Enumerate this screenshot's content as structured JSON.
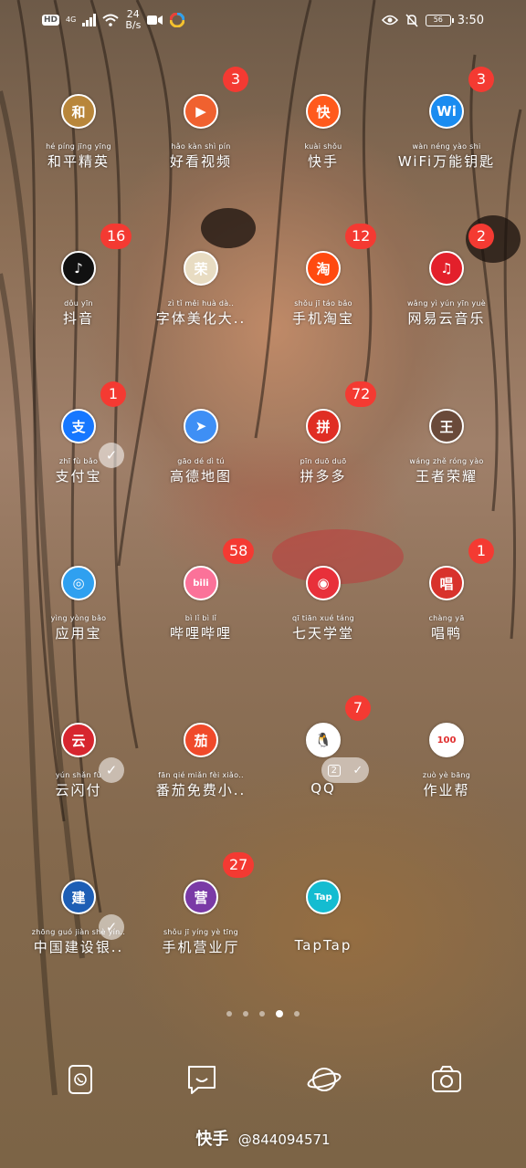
{
  "statusbar": {
    "hd": "HD",
    "network": "4G",
    "speed_value": "24",
    "speed_unit": "B/s",
    "battery": "56",
    "time": "3:50"
  },
  "apps": [
    {
      "pinyin": "hé píng jīng yīng",
      "label": "和平精英",
      "badge": "",
      "color": "#b8863b",
      "glyph": "和"
    },
    {
      "pinyin": "hǎo kàn shì pín",
      "label": "好看视频",
      "badge": "3",
      "color": "#f0612f",
      "glyph": "▶"
    },
    {
      "pinyin": "kuài shǒu",
      "label": "快手",
      "badge": "",
      "color": "#ff5a1c",
      "glyph": "快"
    },
    {
      "pinyin": "wàn néng yào shi",
      "label": "WiFi万能钥匙",
      "badge": "3",
      "color": "#1a8cf0",
      "glyph": "Wi"
    },
    {
      "pinyin": "dǒu yīn",
      "label": "抖音",
      "badge": "16",
      "color": "#111111",
      "glyph": "♪"
    },
    {
      "pinyin": "zì tǐ měi huà dà..",
      "label": "字体美化大..",
      "badge": "",
      "color": "#e8dcc2",
      "glyph": "荣"
    },
    {
      "pinyin": "shǒu jī táo bǎo",
      "label": "手机淘宝",
      "badge": "12",
      "color": "#ff4a10",
      "glyph": "淘"
    },
    {
      "pinyin": "wǎng yì yún yīn yuè",
      "label": "网易云音乐",
      "badge": "2",
      "color": "#e3202b",
      "glyph": "♫"
    },
    {
      "pinyin": "zhī fù bǎo",
      "label": "支付宝",
      "badge": "1",
      "color": "#1677ff",
      "glyph": "支"
    },
    {
      "pinyin": "gāo dé dì tú",
      "label": "高德地图",
      "badge": "",
      "color": "#3e8ff5",
      "glyph": "➤"
    },
    {
      "pinyin": "pīn duō duō",
      "label": "拼多多",
      "badge": "72",
      "color": "#e02e24",
      "glyph": "拼"
    },
    {
      "pinyin": "wáng zhě róng yào",
      "label": "王者荣耀",
      "badge": "",
      "color": "#6a4a3a",
      "glyph": "王"
    },
    {
      "pinyin": "yìng yòng bǎo",
      "label": "应用宝",
      "badge": "",
      "color": "#2fa0f0",
      "glyph": "◎"
    },
    {
      "pinyin": "bì lǐ bì lǐ",
      "label": "哔哩哔哩",
      "badge": "58",
      "color": "#fb7299",
      "glyph": "bili"
    },
    {
      "pinyin": "qī tiān xué táng",
      "label": "七天学堂",
      "badge": "",
      "color": "#e8303a",
      "glyph": "◉"
    },
    {
      "pinyin": "chàng yā",
      "label": "唱鸭",
      "badge": "1",
      "color": "#d8322c",
      "glyph": "唱"
    },
    {
      "pinyin": "yún shǎn fù",
      "label": "云闪付",
      "badge": "",
      "color": "#d7262f",
      "glyph": "云"
    },
    {
      "pinyin": "fān qié miǎn fèi xiǎo..",
      "label": "番茄免费小..",
      "badge": "",
      "color": "#f04a2a",
      "glyph": "茄"
    },
    {
      "pinyin": "",
      "label": "QQ",
      "badge": "7",
      "color": "#ffffff",
      "glyph": "🐧"
    },
    {
      "pinyin": "zuò yè bāng",
      "label": "作业帮",
      "badge": "",
      "color": "#ffffff",
      "glyph": "100"
    },
    {
      "pinyin": "zhōng guó jiàn shè yín..",
      "label": "中国建设银..",
      "badge": "",
      "color": "#1d5eb5",
      "glyph": "建"
    },
    {
      "pinyin": "shǒu jī yíng yè tīng",
      "label": "手机营业厅",
      "badge": "27",
      "color": "#7a3aa6",
      "glyph": "营"
    },
    {
      "pinyin": "",
      "label": "TapTap",
      "badge": "",
      "color": "#14bcd1",
      "glyph": "Tap"
    }
  ],
  "twin_app_marker": "2",
  "dock": [
    {
      "name": "phone-icon"
    },
    {
      "name": "messages-icon"
    },
    {
      "name": "browser-icon"
    },
    {
      "name": "camera-icon"
    }
  ],
  "watermark": {
    "brand": "快手",
    "handle": "@844094571"
  }
}
